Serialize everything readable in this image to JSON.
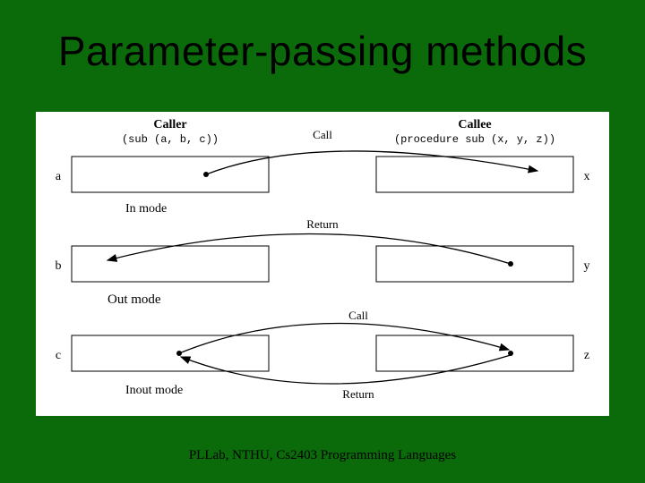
{
  "title": "Parameter-passing methods",
  "footer": "PLLab, NTHU, Cs2403 Programming Languages",
  "diagram": {
    "caller_heading": "Caller",
    "callee_heading": "Callee",
    "caller_sig": "(sub (a, b, c))",
    "callee_sig": "(procedure sub (x, y, z))",
    "top_arrow_label": "Call",
    "rows": [
      {
        "left_label": "a",
        "right_label": "x",
        "mode_label": "In mode",
        "arrows": [
          {
            "type": "call",
            "direction": "right"
          }
        ]
      },
      {
        "left_label": "b",
        "right_label": "y",
        "mode_label": "Out mode",
        "arrows": [
          {
            "type": "return",
            "direction": "left"
          }
        ]
      },
      {
        "left_label": "c",
        "right_label": "z",
        "mode_label": "Inout mode",
        "arrows": [
          {
            "type": "call",
            "direction": "right"
          },
          {
            "type": "return",
            "direction": "left"
          }
        ]
      }
    ],
    "arrow_labels": {
      "call": "Call",
      "return": "Return"
    }
  }
}
